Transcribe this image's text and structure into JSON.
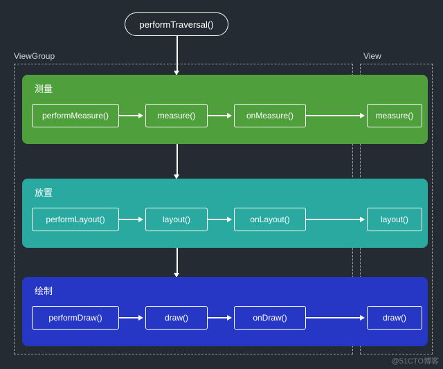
{
  "top": {
    "label": "performTraversal()"
  },
  "groups": {
    "viewgroup_label": "ViewGroup",
    "view_label": "View"
  },
  "sections": {
    "measure": {
      "title": "测量",
      "color": "#4f9f3c",
      "nodes": [
        "performMeasure()",
        "measure()",
        "onMeasure()"
      ],
      "view_node": "measure()"
    },
    "layout": {
      "title": "放置",
      "color": "#2aa9a0",
      "nodes": [
        "performLayout()",
        "layout()",
        "onLayout()"
      ],
      "view_node": "layout()"
    },
    "draw": {
      "title": "绘制",
      "color": "#2636c5",
      "nodes": [
        "performDraw()",
        "draw()",
        "onDraw()"
      ],
      "view_node": "draw()"
    }
  },
  "watermark": "@51CTO博客",
  "chart_data": {
    "type": "flowchart",
    "title": "Android View Traversal Flow",
    "groups": [
      "ViewGroup",
      "View"
    ],
    "nodes": [
      {
        "id": "performTraversal",
        "label": "performTraversal()",
        "group": null
      },
      {
        "id": "performMeasure",
        "label": "performMeasure()",
        "group": "ViewGroup",
        "phase": "测量"
      },
      {
        "id": "vg_measure",
        "label": "measure()",
        "group": "ViewGroup",
        "phase": "测量"
      },
      {
        "id": "onMeasure",
        "label": "onMeasure()",
        "group": "ViewGroup",
        "phase": "测量"
      },
      {
        "id": "v_measure",
        "label": "measure()",
        "group": "View",
        "phase": "测量"
      },
      {
        "id": "performLayout",
        "label": "performLayout()",
        "group": "ViewGroup",
        "phase": "放置"
      },
      {
        "id": "vg_layout",
        "label": "layout()",
        "group": "ViewGroup",
        "phase": "放置"
      },
      {
        "id": "onLayout",
        "label": "onLayout()",
        "group": "ViewGroup",
        "phase": "放置"
      },
      {
        "id": "v_layout",
        "label": "layout()",
        "group": "View",
        "phase": "放置"
      },
      {
        "id": "performDraw",
        "label": "performDraw()",
        "group": "ViewGroup",
        "phase": "绘制"
      },
      {
        "id": "vg_draw",
        "label": "draw()",
        "group": "ViewGroup",
        "phase": "绘制"
      },
      {
        "id": "onDraw",
        "label": "onDraw()",
        "group": "ViewGroup",
        "phase": "绘制"
      },
      {
        "id": "v_draw",
        "label": "draw()",
        "group": "View",
        "phase": "绘制"
      }
    ],
    "edges": [
      [
        "performTraversal",
        "performMeasure"
      ],
      [
        "performMeasure",
        "vg_measure"
      ],
      [
        "vg_measure",
        "onMeasure"
      ],
      [
        "onMeasure",
        "v_measure"
      ],
      [
        "performMeasure",
        "performLayout"
      ],
      [
        "performLayout",
        "vg_layout"
      ],
      [
        "vg_layout",
        "onLayout"
      ],
      [
        "onLayout",
        "v_layout"
      ],
      [
        "performLayout",
        "performDraw"
      ],
      [
        "performDraw",
        "vg_draw"
      ],
      [
        "vg_draw",
        "onDraw"
      ],
      [
        "onDraw",
        "v_draw"
      ]
    ]
  }
}
